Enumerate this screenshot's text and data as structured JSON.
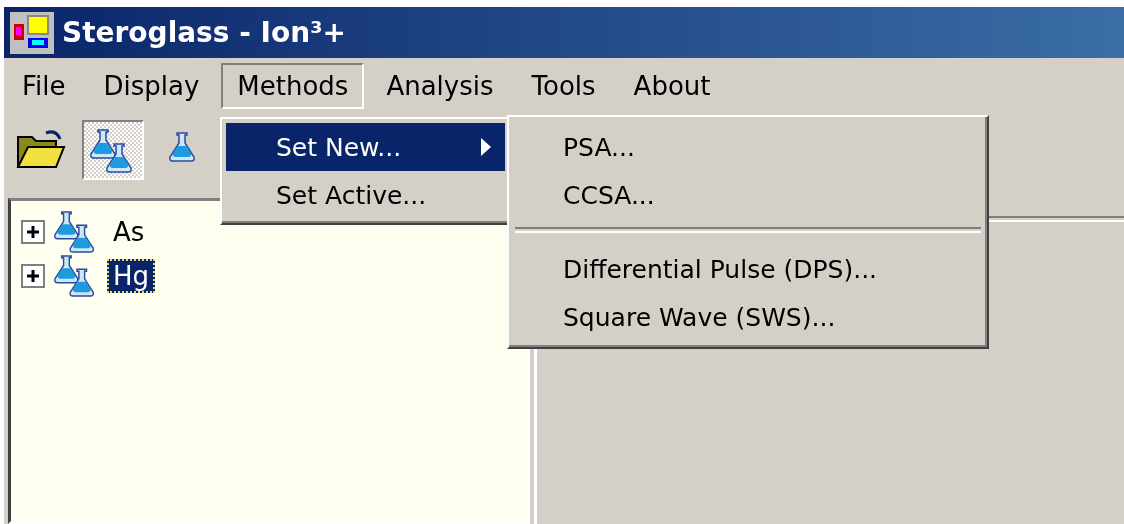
{
  "window": {
    "title": "Steroglass - Ion³+"
  },
  "menu_bar": [
    {
      "label": "File",
      "selected": false
    },
    {
      "label": "Display",
      "selected": false
    },
    {
      "label": "Methods",
      "selected": true
    },
    {
      "label": "Analysis",
      "selected": false
    },
    {
      "label": "Tools",
      "selected": false
    },
    {
      "label": "About",
      "selected": false
    }
  ],
  "toolbar": [
    {
      "pressed": false
    },
    {
      "pressed": true
    },
    {
      "pressed": false
    }
  ],
  "dropdown": {
    "items": [
      {
        "label": "Set New...",
        "selected": true,
        "has_submenu": true
      },
      {
        "label": "Set Active...",
        "selected": false,
        "has_submenu": false
      }
    ]
  },
  "submenu": {
    "items": [
      {
        "kind": "item",
        "label": "PSA...",
        "selected": false
      },
      {
        "kind": "item",
        "label": "CCSA...",
        "selected": false
      },
      {
        "kind": "separator"
      },
      {
        "kind": "item",
        "label": "Differential Pulse (DPS)...",
        "selected": false
      },
      {
        "kind": "item",
        "label": "Square Wave (SWS)...",
        "selected": false
      }
    ]
  },
  "tree": [
    {
      "label": "As",
      "expanded": false,
      "selected": false
    },
    {
      "label": "Hg",
      "expanded": false,
      "selected": true
    }
  ]
}
